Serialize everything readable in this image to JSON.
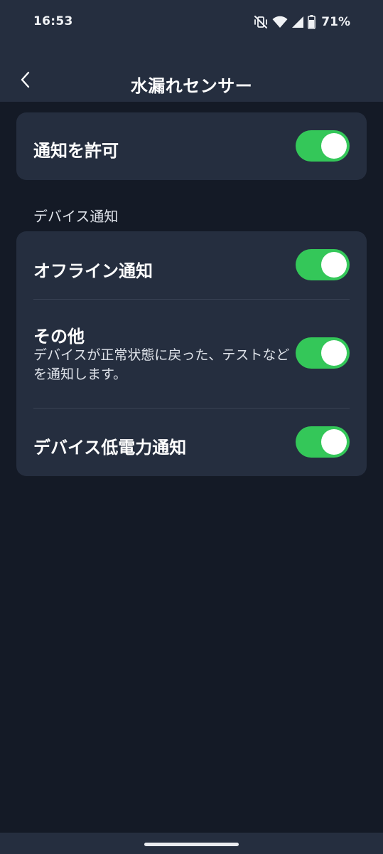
{
  "status_bar": {
    "time": "16:53",
    "battery_percent": "71%",
    "icons": [
      "mute-vibrate-icon",
      "wifi-icon",
      "signal-icon",
      "battery-icon"
    ]
  },
  "app_bar": {
    "title": "水漏れセンサー",
    "back_icon": "chevron-left-icon"
  },
  "allow_section": {
    "label": "通知を許可",
    "enabled": true
  },
  "device_section": {
    "header": "デバイス通知",
    "items": [
      {
        "label": "オフライン通知",
        "description": "",
        "enabled": true
      },
      {
        "label": "その他",
        "description": "デバイスが正常状態に戻った、テストなどを通知します。",
        "enabled": true
      },
      {
        "label": "デバイス低電力通知",
        "description": "",
        "enabled": true
      }
    ]
  },
  "colors": {
    "background": "#141a26",
    "card": "#252e3f",
    "toggle_on": "#34c759"
  }
}
